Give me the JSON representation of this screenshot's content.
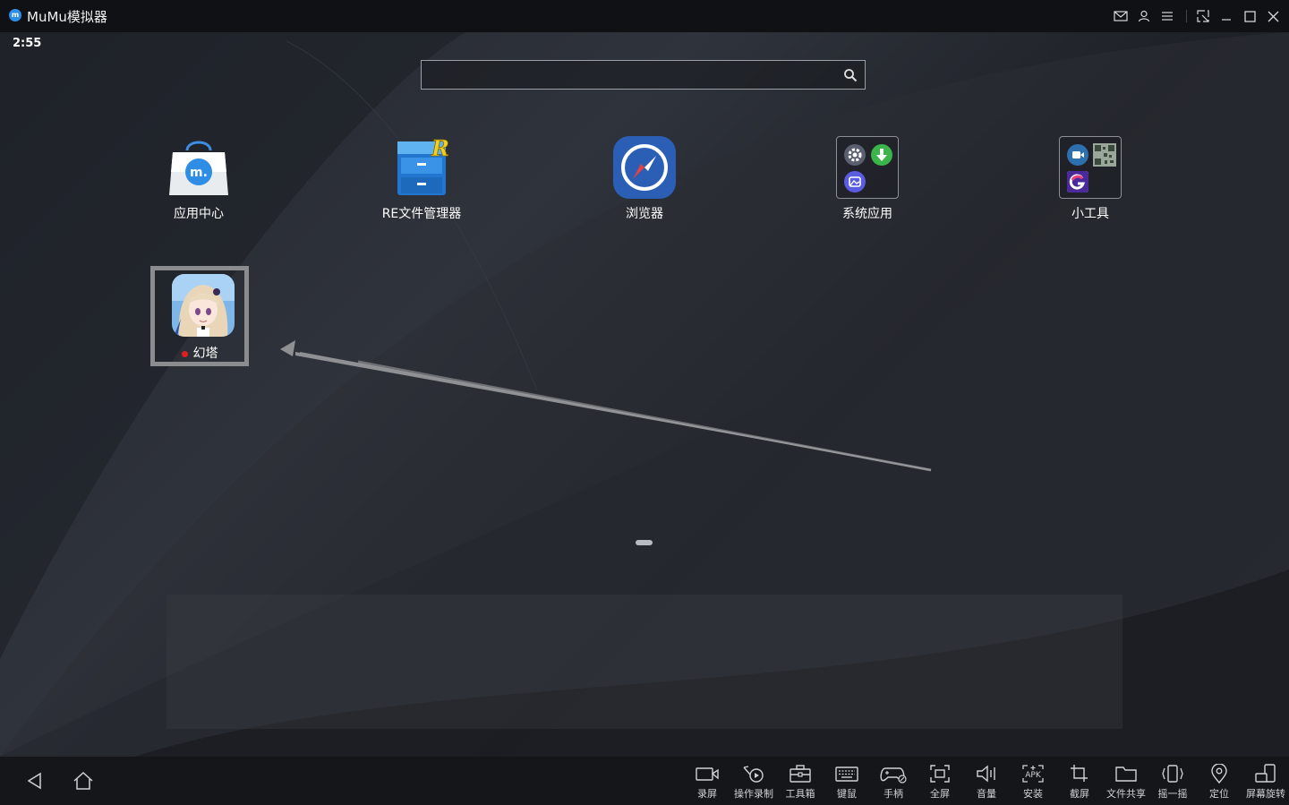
{
  "window": {
    "logo_text": "m",
    "title": "MuMu模拟器",
    "controls": [
      "mail-icon",
      "user-icon",
      "menu-icon",
      "pin-icon",
      "minimize-icon",
      "maximize-icon",
      "close-icon"
    ]
  },
  "status": {
    "time": "2:55"
  },
  "search": {
    "value": "",
    "placeholder": ""
  },
  "apps": [
    {
      "label": "应用中心",
      "icon": "app-center-icon"
    },
    {
      "label": "RE文件管理器",
      "icon": "re-file-manager-icon"
    },
    {
      "label": "浏览器",
      "icon": "browser-compass-icon"
    },
    {
      "label": "系统应用",
      "icon": "folder-system-apps-icon"
    },
    {
      "label": "小工具",
      "icon": "folder-tools-icon"
    }
  ],
  "selected_app": {
    "label": "幻塔",
    "icon": "tower-of-fantasy-icon",
    "has_update_dot": true
  },
  "navbar": {
    "back": "back-icon",
    "home": "home-icon",
    "tools": [
      {
        "label": "录屏",
        "icon": "record-screen-icon"
      },
      {
        "label": "操作录制",
        "icon": "macro-record-icon"
      },
      {
        "label": "工具箱",
        "icon": "toolbox-icon"
      },
      {
        "label": "键鼠",
        "icon": "keyboard-icon"
      },
      {
        "label": "手柄",
        "icon": "gamepad-icon"
      },
      {
        "label": "全屏",
        "icon": "fullscreen-icon"
      },
      {
        "label": "音量",
        "icon": "volume-icon"
      },
      {
        "label": "安装",
        "icon": "apk-install-icon"
      },
      {
        "label": "截屏",
        "icon": "screenshot-crop-icon"
      },
      {
        "label": "文件共享",
        "icon": "file-share-icon"
      },
      {
        "label": "摇一摇",
        "icon": "shake-icon"
      },
      {
        "label": "定位",
        "icon": "location-icon"
      },
      {
        "label": "屏幕旋转",
        "icon": "rotate-screen-icon"
      }
    ]
  }
}
